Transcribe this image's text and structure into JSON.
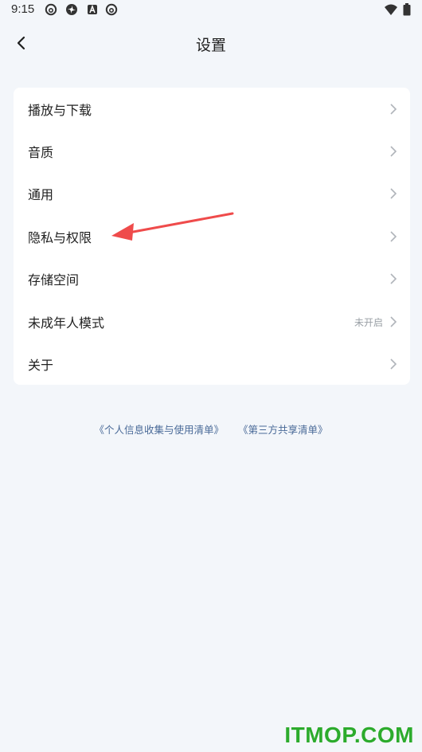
{
  "status_bar": {
    "time": "9:15",
    "icons": [
      "netease-music-icon",
      "pinwheel-icon",
      "a-badge-icon",
      "netease-music-icon",
      "wifi-icon",
      "battery-icon"
    ]
  },
  "header": {
    "title": "设置",
    "back_icon": "chevron-left-icon"
  },
  "settings": {
    "items": [
      {
        "label": "播放与下载",
        "value": ""
      },
      {
        "label": "音质",
        "value": ""
      },
      {
        "label": "通用",
        "value": ""
      },
      {
        "label": "隐私与权限",
        "value": ""
      },
      {
        "label": "存储空间",
        "value": ""
      },
      {
        "label": "未成年人模式",
        "value": "未开启"
      },
      {
        "label": "关于",
        "value": ""
      }
    ]
  },
  "footer_links": {
    "privacy_list": "《个人信息收集与使用清单》",
    "third_party_list": "《第三方共享清单》"
  },
  "annotation": {
    "color": "#ef4b4b"
  },
  "watermark": {
    "text": "ITMOP.COM",
    "color": "#2cab2c"
  },
  "colors": {
    "background": "#f3f6fa",
    "card": "#ffffff",
    "link": "#4a6a98",
    "chevron": "#b0b4ba"
  }
}
